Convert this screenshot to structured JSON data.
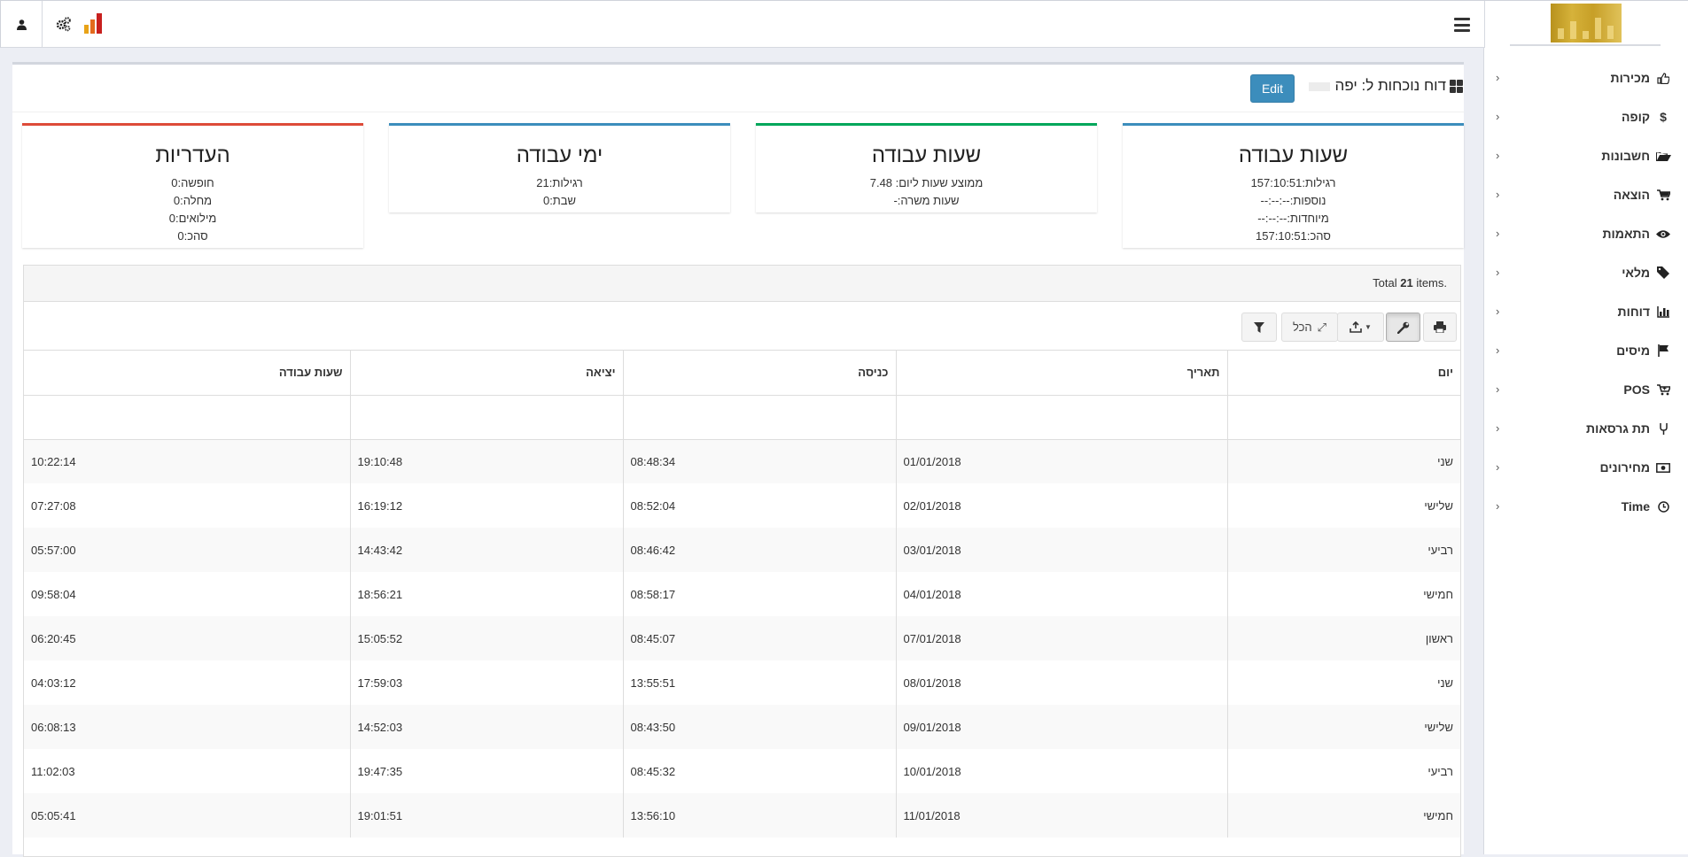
{
  "panel": {
    "title": "דוח נוכחות ל: יפה",
    "edit_label": "Edit"
  },
  "sidebar": {
    "items": [
      {
        "label": "מכירות",
        "icon": "thumbs-up-icon"
      },
      {
        "label": "קופה",
        "icon": "dollar-icon"
      },
      {
        "label": "חשבונות",
        "icon": "folder-open-icon"
      },
      {
        "label": "הוצאה",
        "icon": "shopping-cart-icon"
      },
      {
        "label": "התאמות",
        "icon": "eye-icon"
      },
      {
        "label": "מלאי",
        "icon": "tag-icon"
      },
      {
        "label": "דוחות",
        "icon": "bar-chart-icon"
      },
      {
        "label": "מיסים",
        "icon": "flag-icon"
      },
      {
        "label": "POS",
        "icon": "cart-plus-icon"
      },
      {
        "label": "תת גרסאות",
        "icon": "code-fork-icon"
      },
      {
        "label": "מחירונים",
        "icon": "money-icon"
      },
      {
        "label": "Time",
        "icon": "clock-icon"
      }
    ]
  },
  "stats": {
    "work_hours": {
      "title": "שעות עבודה",
      "lines": [
        "רגילות:157:10:51",
        "נוספות:--:--:--",
        "מיוחדות:--:--:--",
        "סהכ:157:10:51"
      ]
    },
    "work_hours_avg": {
      "title": "שעות עבודה",
      "lines": [
        "ממוצע שעות ליום: 7.48",
        "שעות משרה:-"
      ]
    },
    "work_days": {
      "title": "ימי עבודה",
      "lines": [
        "רגילות:21",
        "שבת:0"
      ]
    },
    "absences": {
      "title": "העדריות",
      "lines": [
        "חופשה:0",
        "מחלה:0",
        "מילואים:0",
        "סהכ:0"
      ]
    }
  },
  "grid": {
    "summary_prefix": "Total ",
    "summary_count": "21",
    "summary_suffix": " items.",
    "expand_all_label": "הכל",
    "columns": [
      "יום",
      "תאריך",
      "כניסה",
      "יציאה",
      "שעות עבודה"
    ],
    "rows": [
      [
        "שני",
        "01/01/2018",
        "08:48:34",
        "19:10:48",
        "10:22:14"
      ],
      [
        "שלישי",
        "02/01/2018",
        "08:52:04",
        "16:19:12",
        "07:27:08"
      ],
      [
        "רביעי",
        "03/01/2018",
        "08:46:42",
        "14:43:42",
        "05:57:00"
      ],
      [
        "חמישי",
        "04/01/2018",
        "08:58:17",
        "18:56:21",
        "09:58:04"
      ],
      [
        "ראשון",
        "07/01/2018",
        "08:45:07",
        "15:05:52",
        "06:20:45"
      ],
      [
        "שני",
        "08/01/2018",
        "13:55:51",
        "17:59:03",
        "04:03:12"
      ],
      [
        "שלישי",
        "09/01/2018",
        "08:43:50",
        "14:52:03",
        "06:08:13"
      ],
      [
        "רביעי",
        "10/01/2018",
        "08:45:32",
        "19:47:35",
        "11:02:03"
      ],
      [
        "חמישי",
        "11/01/2018",
        "13:56:10",
        "19:01:51",
        "05:05:41"
      ]
    ]
  },
  "colors": {
    "primary": "#3c8dbc",
    "success": "#00a65a",
    "danger": "#dd4b39"
  }
}
